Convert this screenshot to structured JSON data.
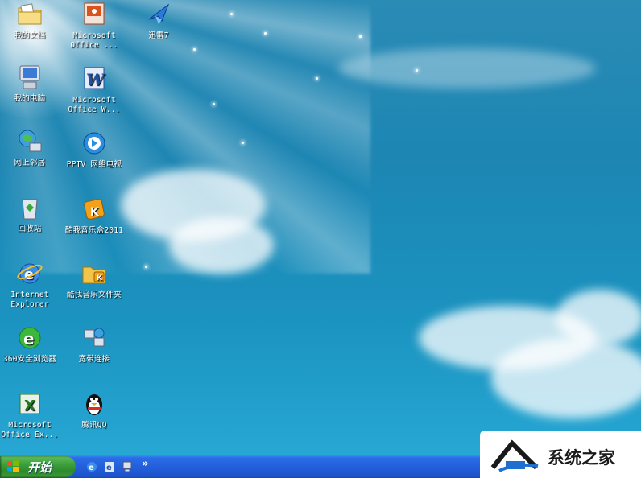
{
  "desktop": {
    "icons": [
      {
        "label": "我的文档"
      },
      {
        "label": "我的电脑"
      },
      {
        "label": "网上邻居"
      },
      {
        "label": "回收站"
      },
      {
        "label": "Internet Explorer"
      },
      {
        "label": "360安全浏览器"
      },
      {
        "label": "Microsoft Office Ex..."
      },
      {
        "label": "Microsoft Office ..."
      },
      {
        "label": "Microsoft Office W..."
      },
      {
        "label": "PPTV 网络电视"
      },
      {
        "label": "酷我音乐盒2011"
      },
      {
        "label": "酷我音乐文件夹"
      },
      {
        "label": "宽带连接"
      },
      {
        "label": "腾讯QQ"
      },
      {
        "label": "迅雷7"
      }
    ]
  },
  "taskbar": {
    "start_label": "开始",
    "quick_launch": [
      "internet-explorer-icon",
      "ie-alt-icon",
      "show-desktop-icon"
    ],
    "overflow": "»"
  },
  "watermark": {
    "text": "系统之家"
  },
  "colors": {
    "taskbar": "#245edb",
    "start": "#3c9e3a",
    "sky": "#1d86b3"
  }
}
